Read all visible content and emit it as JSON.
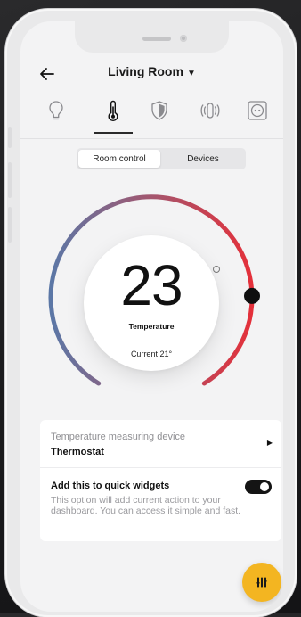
{
  "header": {
    "title": "Living Room",
    "back_icon": "arrow-left-icon",
    "dropdown_icon": "caret-down-icon"
  },
  "categories": [
    {
      "name": "lightbulb-icon",
      "active": false
    },
    {
      "name": "thermometer-icon",
      "active": true
    },
    {
      "name": "shield-icon",
      "active": false
    },
    {
      "name": "vibration-icon",
      "active": false
    },
    {
      "name": "socket-icon",
      "active": false
    }
  ],
  "segment": {
    "active": "Room control",
    "other": "Devices"
  },
  "thermostat": {
    "temperature": "23",
    "label": "Temperature",
    "current": "Current 21°",
    "set_level": 0.8,
    "colors": {
      "cold": "#5b77a6",
      "hot": "#e4303a",
      "knob": "#0f0f0f"
    }
  },
  "settings": {
    "device_label": "Temperature measuring device",
    "device_value": "Thermostat",
    "widgets_label": "Add this to quick widgets",
    "widgets_description": "This option will add current action to your dashboard. You can access it simple and fast.",
    "widgets_enabled": true
  },
  "fab": {
    "icon": "menu-bars-icon",
    "color": "#f3b521"
  }
}
